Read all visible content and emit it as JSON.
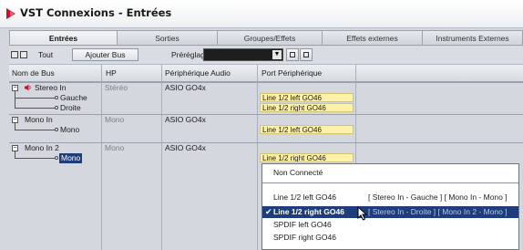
{
  "window": {
    "title": "VST Connexions - Entrées",
    "accent_color": "#c8102e"
  },
  "tabs": [
    {
      "label": "Entrées",
      "active": true
    },
    {
      "label": "Sorties",
      "active": false
    },
    {
      "label": "Groupes/Effets",
      "active": false
    },
    {
      "label": "Effets externes",
      "active": false
    },
    {
      "label": "Instruments Externes",
      "active": false
    }
  ],
  "toolbar": {
    "all_label": "Tout",
    "add_bus_label": "Ajouter Bus",
    "presets_label": "Préréglages",
    "presets_value": ""
  },
  "table": {
    "headers": {
      "bus_name": "Nom de Bus",
      "speakers": "HP",
      "audio_device": "Périphérique Audio",
      "device_port": "Port Périphérique"
    },
    "rows": [
      {
        "name": "Stereo In",
        "hp": "Stéréo",
        "device": "ASIO GO4x",
        "port": ""
      },
      {
        "name": "Gauche",
        "hp": "",
        "device": "",
        "port": "Line 1/2 left GO46"
      },
      {
        "name": "Droite",
        "hp": "",
        "device": "",
        "port": "Line 1/2 right GO46"
      },
      {
        "name": "Mono In",
        "hp": "Mono",
        "device": "ASIO GO4x",
        "port": ""
      },
      {
        "name": "Mono",
        "hp": "",
        "device": "",
        "port": "Line 1/2 left GO46"
      },
      {
        "name": "Mono In 2",
        "hp": "Mono",
        "device": "ASIO GO4x",
        "port": ""
      },
      {
        "name": "Mono",
        "hp": "",
        "device": "",
        "port": "Line 1/2 right GO46"
      }
    ]
  },
  "port_menu": {
    "items": [
      {
        "label": "Non Connecté",
        "info": "",
        "checked": false,
        "selected": false
      },
      {
        "label": "Line 1/2 left GO46",
        "info": "[ Stereo In - Gauche ] [ Mono In - Mono ]",
        "checked": false,
        "selected": false
      },
      {
        "label": "Line 1/2 right GO46",
        "info": "[ Stereo In - Droite ] [ Mono In 2 - Mono ]",
        "checked": true,
        "selected": true
      },
      {
        "label": "SPDIF left GO46",
        "info": "",
        "checked": false,
        "selected": false
      },
      {
        "label": "SPDIF right GO46",
        "info": "",
        "checked": false,
        "selected": false
      }
    ]
  },
  "icons": [
    "cubase-logo-icon",
    "expand-all-icon",
    "collapse-all-icon",
    "save-preset-icon",
    "delete-preset-icon",
    "speaker-icon",
    "checkmark-icon",
    "mouse-cursor-icon"
  ]
}
